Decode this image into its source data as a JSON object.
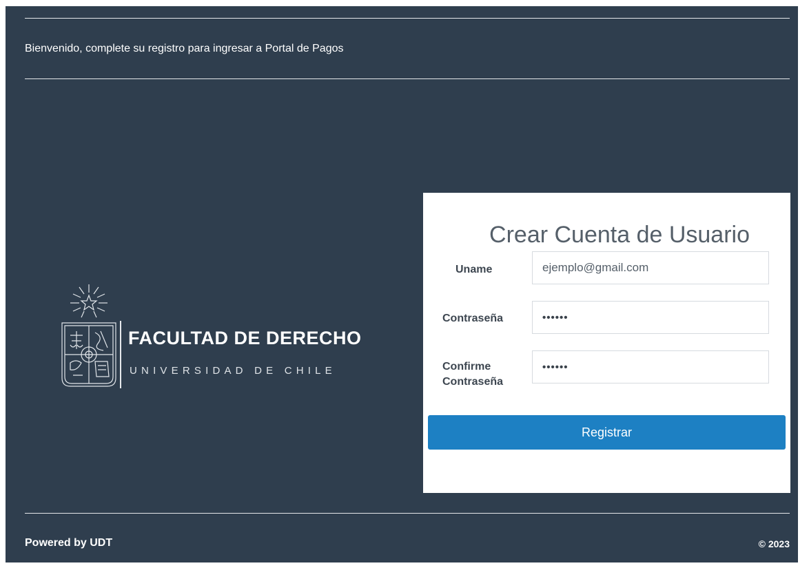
{
  "header": {
    "welcome_text": "Bienvenido, complete su registro para ingresar a Portal de Pagos"
  },
  "logo": {
    "title": "FACULTAD DE DERECHO",
    "subtitle": "UNIVERSIDAD DE CHILE"
  },
  "form": {
    "title": "Crear Cuenta de Usuario",
    "fields": [
      {
        "label": "Uname",
        "placeholder": "ejemplo@gmail.com",
        "value": ""
      },
      {
        "label": "Contraseña",
        "value": "••••••"
      },
      {
        "label_line1": "Confirme",
        "label_line2": "Contraseña",
        "value": "••••••"
      }
    ],
    "submit_label": "Registrar"
  },
  "footer": {
    "left_text": "Powered by UDT",
    "right_text": "© 2023"
  },
  "colors": {
    "background": "#2f3e4e",
    "card": "#ffffff",
    "button": "#1d80c3"
  }
}
